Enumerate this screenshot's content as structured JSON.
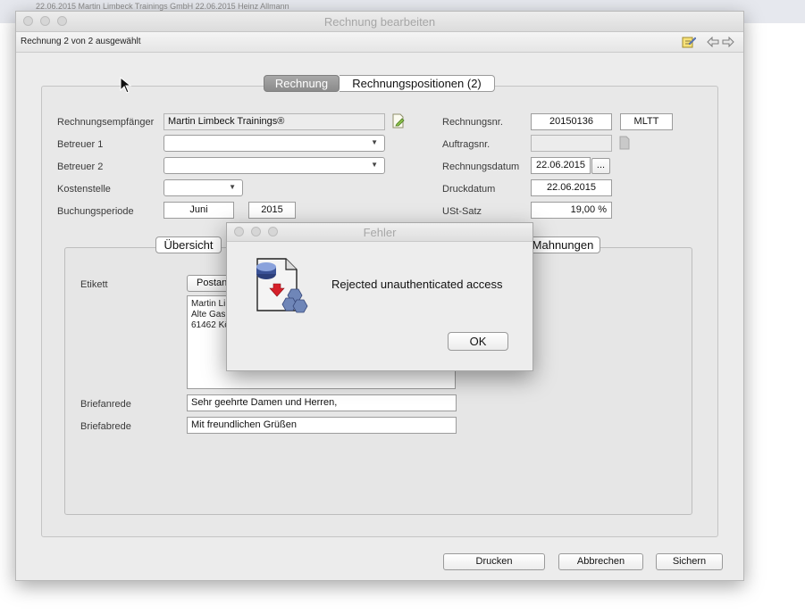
{
  "background_strip": {
    "text": "22.06.2015          Martin Limbeck Trainings GmbH                                   22.06.2015            Heinz Allmann"
  },
  "window": {
    "title": "Rechnung bearbeiten",
    "subheader": "Rechnung 2 von 2 ausgewählt"
  },
  "tabs": {
    "rechnung": "Rechnung",
    "positionen": "Rechnungspositionen (2)"
  },
  "form_left": {
    "empfaenger_label": "Rechnungsempfänger",
    "empfaenger_value": "Martin Limbeck Trainings®",
    "betreuer1_label": "Betreuer 1",
    "betreuer1_value": "",
    "betreuer2_label": "Betreuer 2",
    "betreuer2_value": "",
    "kostenstelle_label": "Kostenstelle",
    "kostenstelle_value": "",
    "buchungsperiode_label": "Buchungsperiode",
    "buchung_month": "Juni",
    "buchung_year": "2015"
  },
  "form_right": {
    "rechnungsnr_label": "Rechnungsnr.",
    "rechnungsnr_value": "20150136",
    "kuerzel": "MLTT",
    "auftragsnr_label": "Auftragsnr.",
    "auftragsnr_value": "",
    "rechnungsdatum_label": "Rechnungsdatum",
    "rechnungsdatum_value": "22.06.2015",
    "date_picker": "...",
    "druckdatum_label": "Druckdatum",
    "druckdatum_value": "22.06.2015",
    "ust_label": "USt-Satz",
    "ust_value": "19,00 %"
  },
  "inner_tabs": {
    "uebersicht": "Übersicht",
    "mahnungen": "Mahnungen"
  },
  "inner": {
    "etikett_label": "Etikett",
    "etikett_select": "Postans",
    "address_lines": [
      "Martin Li",
      "Alte Gas",
      "61462 Kö"
    ],
    "briefanrede_label": "Briefanrede",
    "briefanrede_value": "Sehr geehrte Damen und Herren,",
    "briefabrede_label": "Briefabrede",
    "briefabrede_value": "Mit freundlichen Grüßen"
  },
  "buttons": {
    "drucken": "Drucken",
    "abbrechen": "Abbrechen",
    "sichern": "Sichern"
  },
  "dialog": {
    "title": "Fehler",
    "message": "Rejected unauthenticated access",
    "ok": "OK"
  },
  "icons": {
    "empfaenger_edit": "edit-document-icon",
    "auftrag_doc": "document-icon",
    "toolbar_note": "note-pencil-icon",
    "nav_back": "arrow-left-icon",
    "nav_forward": "arrow-right-icon",
    "dialog_app": "database-document-icon",
    "cursor": "mouse-pointer-icon"
  }
}
